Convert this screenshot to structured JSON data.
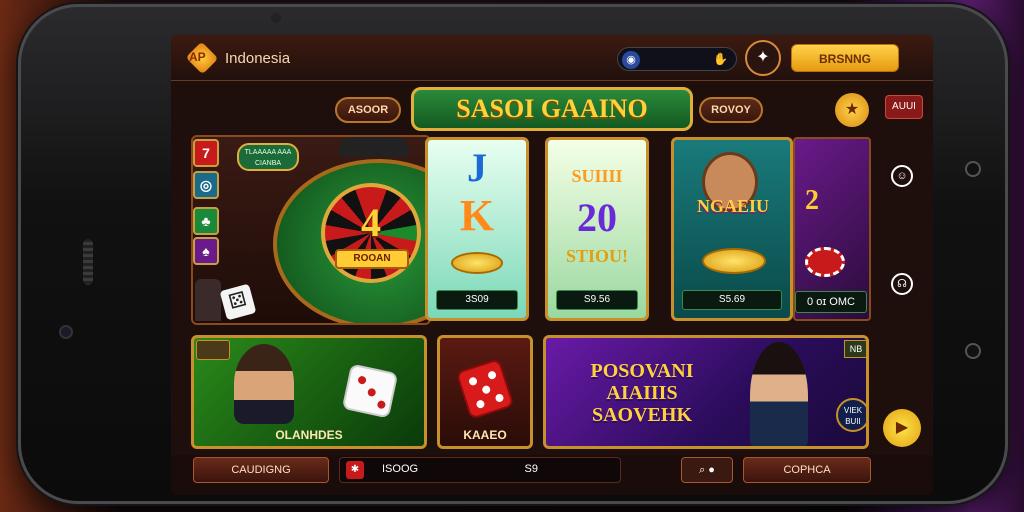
{
  "header": {
    "logo_text": "AP",
    "brand": "Indonesia",
    "sound_icon": "speaker-icon",
    "sound_right": "✋",
    "user_icon": "user-icon",
    "action_button": "BRSNNG"
  },
  "title_row": {
    "left_button": "ASOOR",
    "title": "SASOI GAAINO",
    "right_button": "ROVOY",
    "red_tag": "AUUI"
  },
  "roulette": {
    "label_chip": "TLAAAAA AAA\nCIANBA",
    "number": "4",
    "tag": "ROOAN"
  },
  "reels": [
    {
      "sym1": "J",
      "sym2": "K",
      "value": "3S09"
    },
    {
      "sym1": "SUIIII",
      "sym2": "20",
      "sym3": "STIOU!",
      "value": "S9.56"
    }
  ],
  "hero": {
    "title": "NGAEIU",
    "value": "S5.69"
  },
  "right_strip": {
    "num": "2",
    "value": "0 ᴏɪ OMC"
  },
  "cards": [
    {
      "label": "OLANHDES"
    },
    {
      "label": "KAAEO"
    },
    {
      "title": "POSOVANI AIAIIIS SAOVEHK",
      "badge": "VIEK\nBUII",
      "top": "NB"
    }
  ],
  "bottombar": {
    "left_button": "CAUDIGNG",
    "field_left": "ISOOG",
    "field_right": "S9",
    "right_button": "COPHCA"
  },
  "colors": {
    "accent_gold": "#ffd23a",
    "title_green": "#2a8a3a",
    "brand_text": "#f3d9b0"
  }
}
